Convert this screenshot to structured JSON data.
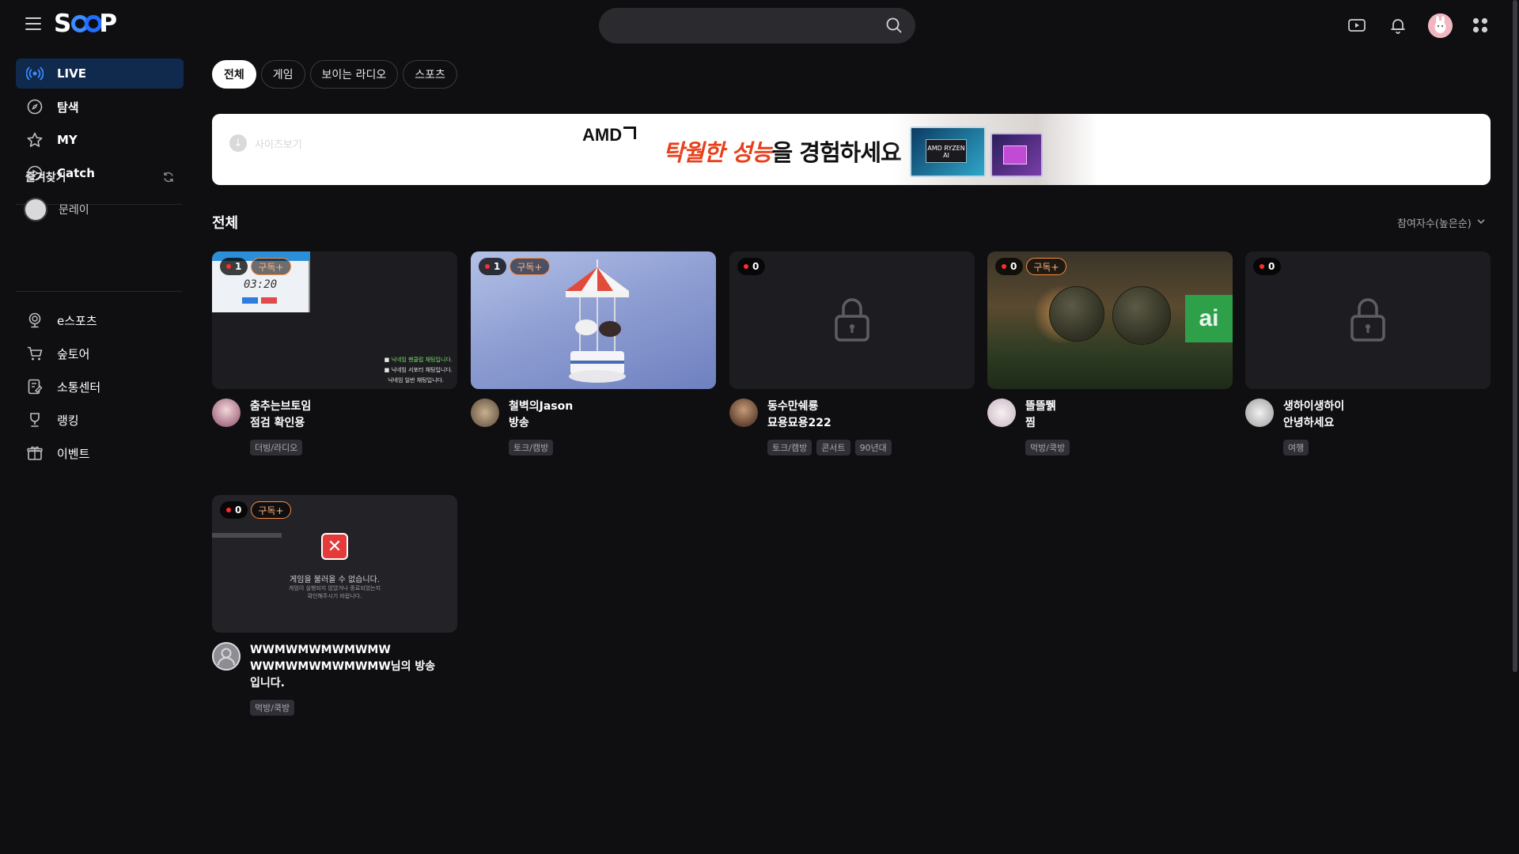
{
  "header": {
    "logo_text": "SOOP",
    "search": {
      "value": "",
      "placeholder": ""
    },
    "icons": [
      "menu-icon",
      "search-icon",
      "broadcast-icon",
      "bell-icon",
      "profile-avatar",
      "apps-grid-icon"
    ]
  },
  "sidebar": {
    "main_items": [
      {
        "label": "LIVE",
        "icon": "live-icon",
        "active": true
      },
      {
        "label": "탐색",
        "icon": "compass-icon"
      },
      {
        "label": "MY",
        "icon": "star-icon"
      },
      {
        "label": "Catch",
        "icon": "catch-icon"
      }
    ],
    "favorites": {
      "title": "즐겨찾기",
      "items": [
        {
          "name": "문레이"
        }
      ]
    },
    "bottom_items": [
      {
        "label": "e스포츠",
        "icon": "trophy-icon"
      },
      {
        "label": "숲토어",
        "icon": "cart-icon"
      },
      {
        "label": "소통센터",
        "icon": "note-icon"
      },
      {
        "label": "랭킹",
        "icon": "ranking-icon"
      },
      {
        "label": "이벤트",
        "icon": "gift-icon"
      }
    ]
  },
  "filters": {
    "chips": [
      {
        "label": "전체",
        "active": true
      },
      {
        "label": "게임"
      },
      {
        "label": "보이는 라디오"
      },
      {
        "label": "스포츠"
      }
    ]
  },
  "banner": {
    "download_text": "사이즈보기",
    "brand": "AMD",
    "headline_highlight": "탁월한 성능",
    "headline_rest": "을 경험하세요",
    "chip_label": "AMD RYZEN AI"
  },
  "section": {
    "title": "전체",
    "sort_label": "참여자수(높은순)"
  },
  "streams": [
    {
      "viewers": "1",
      "subscribe": "구독+",
      "streamer": "춤추는브토임",
      "title": "점검 확인용",
      "tags": [
        "더빙/라디오"
      ],
      "thumb_text": {
        "time": "03:20",
        "chat": [
          "닉네임 팬클럽 채팅입니다.",
          "닉네임 서포터 채팅입니다.",
          "닉네임 일반 채팅입니다."
        ]
      }
    },
    {
      "viewers": "1",
      "subscribe": "구독+",
      "streamer": "철벽의Jason",
      "title": "방송",
      "tags": [
        "토크/캠방"
      ]
    },
    {
      "viewers": "0",
      "subscribe": "",
      "streamer": "동수만쉐룡",
      "title": "묘용묘용222",
      "tags": [
        "토크/캠방",
        "콘서트",
        "90년대"
      ],
      "locked": true
    },
    {
      "viewers": "0",
      "subscribe": "구독+",
      "streamer": "뜰뜰뛝",
      "title": "찜",
      "tags": [
        "먹방/쿡방"
      ],
      "thumb_text": {
        "box": "ai"
      }
    },
    {
      "viewers": "0",
      "subscribe": "",
      "streamer": "생하이생하이",
      "title": "안녕하세요",
      "tags": [
        "여행"
      ],
      "locked": true
    },
    {
      "viewers": "0",
      "subscribe": "구독+",
      "streamer": "WWMWMWMWMWMW",
      "title": "WWMWMWMWMWMW님의 방송입니다.",
      "tags": [
        "먹방/쿡방"
      ],
      "thumb_text": {
        "error": "게임을 불러올 수 없습니다.",
        "error_detail": "게임이 실행되지 않았거나 종료되었는지 확인해주시기 바랍니다."
      }
    }
  ],
  "colors": {
    "accent": "#1f6cff",
    "live_dot": "#ff2d2d",
    "subscribe": "#ff8a3d",
    "active_nav_bg": "#102a4e",
    "banner_highlight": "#e8401c"
  }
}
